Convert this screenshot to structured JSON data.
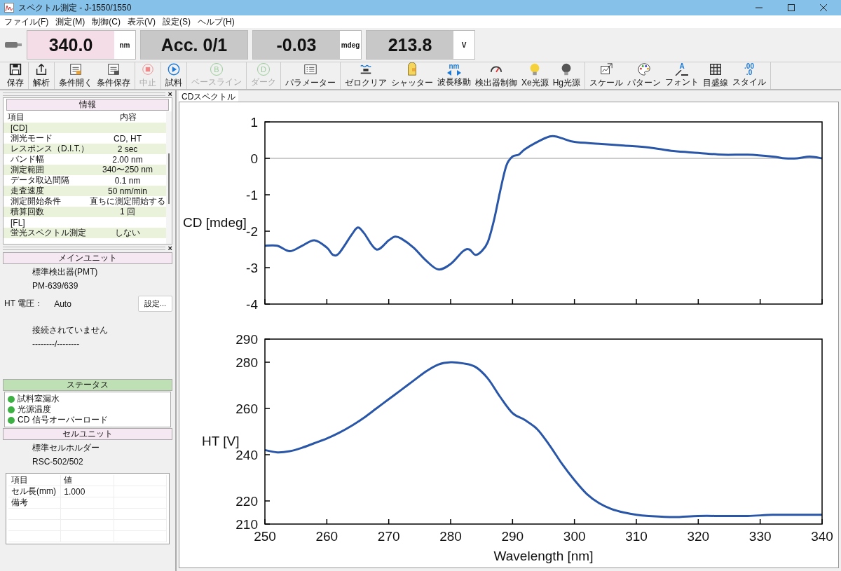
{
  "window": {
    "title": "スペクトル測定 - J-1550/1550"
  },
  "menu": [
    "ファイル(F)",
    "測定(M)",
    "制御(C)",
    "表示(V)",
    "設定(S)",
    "ヘルプ(H)"
  ],
  "readouts": [
    {
      "value": "340.0",
      "unit": "nm",
      "highlighted": true
    },
    {
      "value": "Acc. 0/1",
      "highlighted": false
    },
    {
      "value": "-0.03",
      "unit": "mdeg",
      "highlighted": false
    },
    {
      "value": "213.8",
      "unit": "V",
      "highlighted": false
    }
  ],
  "toolbar": [
    [
      {
        "label": "保存",
        "disabled": false
      }
    ],
    [
      {
        "label": "解析",
        "disabled": false
      }
    ],
    [
      {
        "label": "条件開く",
        "disabled": false
      },
      {
        "label": "条件保存",
        "disabled": false
      }
    ],
    [
      {
        "label": "中止",
        "disabled": true
      }
    ],
    [
      {
        "label": "試料",
        "disabled": false
      }
    ],
    [
      {
        "label": "ベースライン",
        "disabled": true,
        "glyph": [
          "B"
        ]
      }
    ],
    [
      {
        "label": "ダーク",
        "disabled": true,
        "glyph": [
          "D"
        ]
      }
    ],
    [
      {
        "label": "パラメーター",
        "disabled": false
      }
    ],
    [
      {
        "label": "ゼロクリア",
        "disabled": false
      },
      {
        "label": "シャッター",
        "disabled": false
      },
      {
        "label": "波長移動",
        "disabled": false,
        "glyph": [
          "nm"
        ]
      },
      {
        "label": "検出器制御",
        "disabled": false
      },
      {
        "label": "Xe光源",
        "disabled": false
      },
      {
        "label": "Hg光源",
        "disabled": false
      }
    ],
    [
      {
        "label": "スケール",
        "disabled": false
      },
      {
        "label": "パターン",
        "disabled": false
      },
      {
        "label": "フォント",
        "disabled": false,
        "glyph": [
          "A"
        ]
      },
      {
        "label": "目盛線",
        "disabled": false
      },
      {
        "label": "スタイル",
        "disabled": false,
        "glyph": [
          ".00",
          ".0"
        ]
      }
    ]
  ],
  "info_panel": {
    "close": "×",
    "header": "情報",
    "columns": [
      "項目",
      "内容"
    ],
    "rows": [
      {
        "item": "[CD]"
      },
      {
        "item": "測光モード",
        "value": "CD, HT"
      },
      {
        "item": "レスポンス（D.I.T.）",
        "value": "2 sec"
      },
      {
        "item": "バンド幅",
        "value": "2.00 nm"
      },
      {
        "item": "測定範囲",
        "value": "340〜250 nm"
      },
      {
        "item": "データ取込間隔",
        "value": "0.1 nm"
      },
      {
        "item": "走査速度",
        "value": "50 nm/min"
      },
      {
        "item": "測定開始条件",
        "value": "直ちに測定開始する"
      },
      {
        "item": "積算回数",
        "value": "1 回"
      },
      {
        "item": "[FL]"
      },
      {
        "item": "蛍光スペクトル測定",
        "value": "しない"
      }
    ]
  },
  "main_unit": {
    "close": "×",
    "header": "メインユニット",
    "detector": "標準検出器(PMT)",
    "model": "PM-639/639",
    "ht_label": "HT 電圧：",
    "ht_value": "Auto",
    "settings_button": "設定...",
    "connection": "接続されていません",
    "connection_value": "--------/--------"
  },
  "status": {
    "header": "ステータス",
    "items": [
      {
        "label": "試料室漏水",
        "color": "#3cb043"
      },
      {
        "label": "光源温度",
        "color": "#3cb043"
      },
      {
        "label": "CD 信号オーバーロード",
        "color": "#3cb043"
      }
    ]
  },
  "cell_unit": {
    "header": "セルユニット",
    "holder": "標準セルホルダー",
    "model": "RSC-502/502",
    "columns": [
      "項目",
      "値"
    ],
    "rows": [
      {
        "item": "セル長(mm)",
        "value": "1.000"
      },
      {
        "item": "備考"
      }
    ]
  },
  "tabs": [
    {
      "label": "CDスペクトル",
      "selected": true
    }
  ],
  "cd_chart": {
    "chart_data": {
      "type": "line",
      "ylabel": "CD [mdeg]",
      "x": [
        250,
        252,
        254,
        256,
        258,
        260,
        261,
        262,
        264,
        265,
        266,
        268,
        270,
        271,
        272,
        274,
        276,
        278,
        280,
        282,
        283,
        284,
        285,
        286,
        287,
        288,
        289,
        290,
        291,
        292,
        294,
        296,
        297,
        298,
        300,
        304,
        308,
        312,
        316,
        320,
        324,
        328,
        332,
        334,
        336,
        338,
        340
      ],
      "series": [
        {
          "color": "#2a56a8",
          "values": [
            -2.4,
            -2.4,
            -2.55,
            -2.4,
            -2.25,
            -2.45,
            -2.65,
            -2.6,
            -2.1,
            -1.9,
            -2.05,
            -2.5,
            -2.25,
            -2.15,
            -2.2,
            -2.45,
            -2.8,
            -3.05,
            -2.9,
            -2.55,
            -2.5,
            -2.65,
            -2.55,
            -2.3,
            -1.7,
            -0.9,
            -0.2,
            0.05,
            0.1,
            0.25,
            0.45,
            0.6,
            0.6,
            0.55,
            0.45,
            0.4,
            0.35,
            0.3,
            0.2,
            0.15,
            0.1,
            0.1,
            0.05,
            0,
            0,
            0.05,
            0
          ]
        }
      ],
      "xlim": [
        250,
        340
      ],
      "ylim": [
        -4,
        1
      ],
      "yticks": [
        -4,
        -3,
        -2,
        -1,
        0,
        1
      ]
    }
  },
  "ht_chart": {
    "chart_data": {
      "type": "line",
      "xlabel": "Wavelength [nm]",
      "ylabel": "HT [V]",
      "x": [
        250,
        252,
        254,
        256,
        258,
        260,
        262,
        264,
        266,
        268,
        270,
        272,
        274,
        276,
        278,
        280,
        282,
        284,
        286,
        288,
        290,
        292,
        294,
        296,
        298,
        300,
        302,
        304,
        306,
        308,
        310,
        312,
        316,
        320,
        324,
        328,
        332,
        336,
        340
      ],
      "series": [
        {
          "color": "#2a56a8",
          "values": [
            242,
            241,
            241.5,
            243,
            245,
            247,
            249.5,
            252.5,
            256,
            260,
            264,
            268,
            272,
            276,
            279,
            280,
            279.5,
            278,
            273,
            265,
            258,
            255,
            251,
            244,
            236,
            229,
            223,
            219,
            216.5,
            215,
            214,
            213.5,
            213,
            213.5,
            213.5,
            213.5,
            214,
            214,
            214
          ]
        }
      ],
      "xlim": [
        250,
        340
      ],
      "ylim": [
        210,
        290
      ],
      "yticks": [
        210,
        220,
        240,
        260,
        280,
        290
      ],
      "xticks": [
        250,
        260,
        270,
        280,
        290,
        300,
        310,
        320,
        330,
        340
      ]
    }
  }
}
